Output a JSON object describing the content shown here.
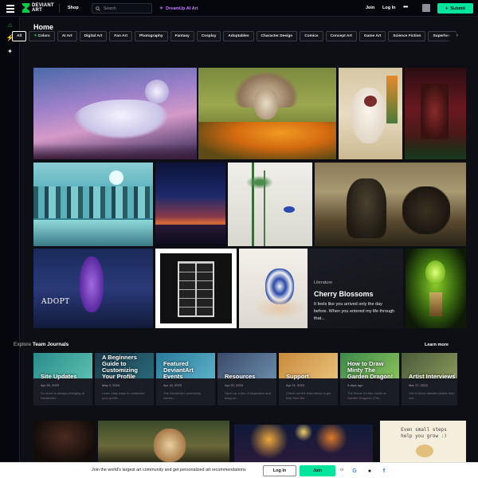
{
  "header": {
    "logo_text_1": "DEVIANT",
    "logo_text_2": "ART",
    "shop_label": "Shop",
    "search_placeholder": "Search",
    "dreamup_label": "DreamUp AI Art",
    "join_label": "Join",
    "login_label": "Log In",
    "more_label": "•••",
    "submit_label": "Submit"
  },
  "sidebar": {
    "items": [
      {
        "icon": "home-icon",
        "glyph": "⌂"
      },
      {
        "icon": "bolt-icon",
        "glyph": "⚡"
      },
      {
        "icon": "spark-icon",
        "glyph": "✦"
      }
    ]
  },
  "page": {
    "title": "Home"
  },
  "chips": [
    "All",
    "Colors",
    "AI Art",
    "Digital Art",
    "Fan Art",
    "Photography",
    "Fantasy",
    "Cosplay",
    "Adoptables",
    "Character Design",
    "Comics",
    "Concept Art",
    "Game Art",
    "Science Fiction",
    "Superhero"
  ],
  "gallery": {
    "adopt_label": "ADOPT",
    "literature": {
      "category": "Literature",
      "title": "Cherry Blossoms",
      "excerpt": "It feels like you arrived only the day before. When you entered my life through that..."
    }
  },
  "journals": {
    "explore_prefix": "Explore",
    "explore_bold": "Team Journals",
    "learn_more": "Learn more",
    "items": [
      {
        "title": "Site Updates",
        "date": "Apr 26, 2023",
        "excerpt": "So much is always changing at DeviantArt..."
      },
      {
        "title": "A Beginners Guide to Customizing Your Profile",
        "date": "May 4, 2024",
        "excerpt": "Learn easy ways to customize your profile ..."
      },
      {
        "title": "Featured DeviantArt Events",
        "date": "Apr 18, 2023",
        "excerpt": "The DeviantArt community comes..."
      },
      {
        "title": "Resources",
        "date": "Apr 20, 2023",
        "excerpt": "Open up a box of inspiration and snag so..."
      },
      {
        "title": "Support",
        "date": "Apr 21, 2023",
        "excerpt": "Check out the links below to get help from the..."
      },
      {
        "title": "How to Draw Minty The Garden Dragon!",
        "date": "4 days ago",
        "excerpt": "The theme for this month is Garden Dragons! (The..."
      },
      {
        "title": "Artist Interviews",
        "date": "Mar 17, 2023",
        "excerpt": "Get to know talented artists from our..."
      }
    ]
  },
  "bottom_art": {
    "note_text": "Even small steps help you grow :)"
  },
  "footer": {
    "text": "Join the world's largest art community and get personalized art recommendations",
    "login_label": "Log In",
    "join_label": "Join",
    "or_label": "or"
  }
}
